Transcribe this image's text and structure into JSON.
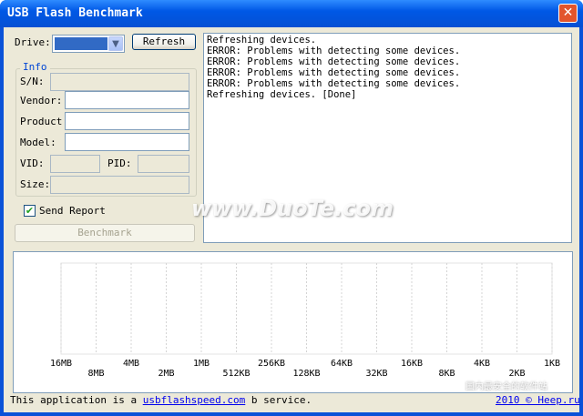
{
  "window": {
    "title": "USB Flash Benchmark"
  },
  "drive": {
    "label": "Drive:",
    "refresh_label": "Refresh"
  },
  "info": {
    "group_title": "Info",
    "sn_label": "S/N:",
    "vendor_label": "Vendor:",
    "product_label": "Product:",
    "model_label": "Model:",
    "vid_label": "VID:",
    "pid_label": "PID:",
    "size_label": "Size:",
    "sn_value": "",
    "vendor_value": "",
    "product_value": "",
    "model_value": "",
    "vid_value": "",
    "pid_value": "",
    "size_value": ""
  },
  "send_report": {
    "label": "Send Report",
    "checked": true
  },
  "benchmark": {
    "label": "Benchmark"
  },
  "log": {
    "lines": [
      "Refreshing devices.",
      "ERROR: Problems with detecting some devices.",
      "ERROR: Problems with detecting some devices.",
      "ERROR: Problems with detecting some devices.",
      "ERROR: Problems with detecting some devices.",
      "Refreshing devices. [Done]"
    ]
  },
  "chart_data": {
    "type": "bar",
    "categories": [
      "16MB",
      "8MB",
      "4MB",
      "2MB",
      "1MB",
      "512KB",
      "256KB",
      "128KB",
      "64KB",
      "32KB",
      "16KB",
      "8KB",
      "4KB",
      "2KB",
      "1KB"
    ],
    "series": [],
    "title": "",
    "xlabel": "",
    "ylabel": "",
    "grid": true
  },
  "footer": {
    "prefix": "This application is a ",
    "link": "usbflashspeed.com",
    "suffix": " b service.",
    "credit": "2010 © Heep.ru"
  },
  "watermark": {
    "main": "www.DuoTe.com",
    "corner": "国内最安全的软件站"
  }
}
